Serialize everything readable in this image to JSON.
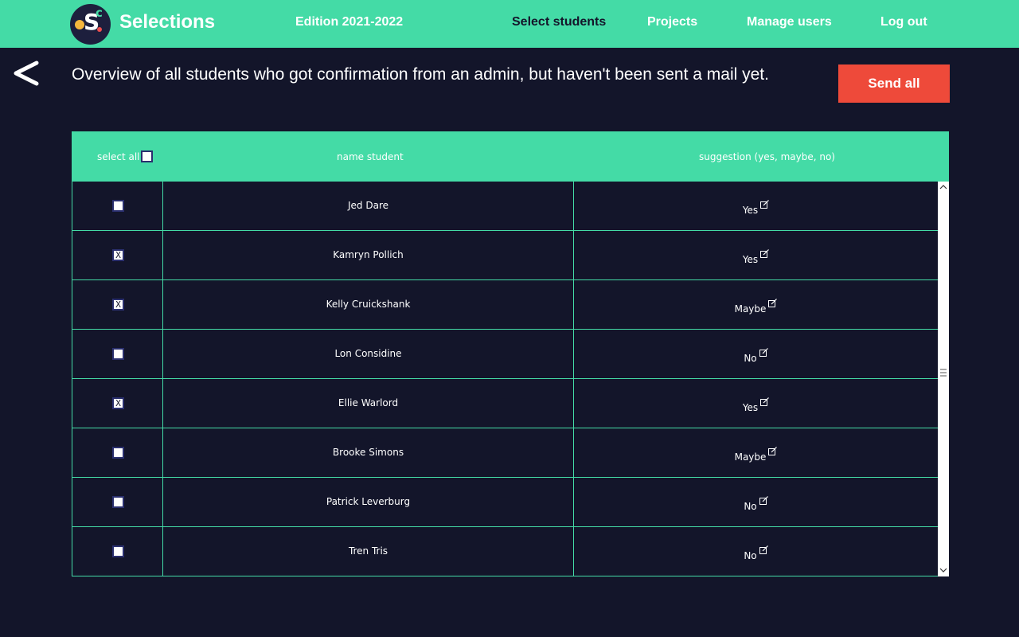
{
  "brand": {
    "name": "Selections"
  },
  "nav": {
    "edition": "Edition 2021-2022",
    "select_students": "Select students",
    "projects": "Projects",
    "manage_users": "Manage users",
    "log_out": "Log out"
  },
  "page": {
    "title": "Overview of all students who got confirmation from an admin, but haven't been sent a mail yet.",
    "send_all_label": "Send all"
  },
  "table": {
    "headers": {
      "select_all": "select all",
      "name": "name student",
      "suggestion": "suggestion (yes, maybe, no)"
    },
    "rows": [
      {
        "checked": "",
        "name": "Jed Dare",
        "suggestion": "Yes"
      },
      {
        "checked": "X",
        "name": "Kamryn Pollich",
        "suggestion": "Yes"
      },
      {
        "checked": "X",
        "name": "Kelly Cruickshank",
        "suggestion": "Maybe"
      },
      {
        "checked": "",
        "name": "Lon Considine",
        "suggestion": "No"
      },
      {
        "checked": "X",
        "name": "Ellie Warlord",
        "suggestion": "Yes"
      },
      {
        "checked": "",
        "name": "Brooke Simons",
        "suggestion": "Maybe"
      },
      {
        "checked": "",
        "name": "Patrick Leverburg",
        "suggestion": "No"
      },
      {
        "checked": "",
        "name": "Tren Tris",
        "suggestion": "No"
      }
    ]
  },
  "colors": {
    "accent": "#44dba6",
    "background": "#13152a",
    "danger": "#ee4a3a"
  },
  "icons": {
    "back": "back-arrow-icon",
    "edit": "edit-icon"
  }
}
